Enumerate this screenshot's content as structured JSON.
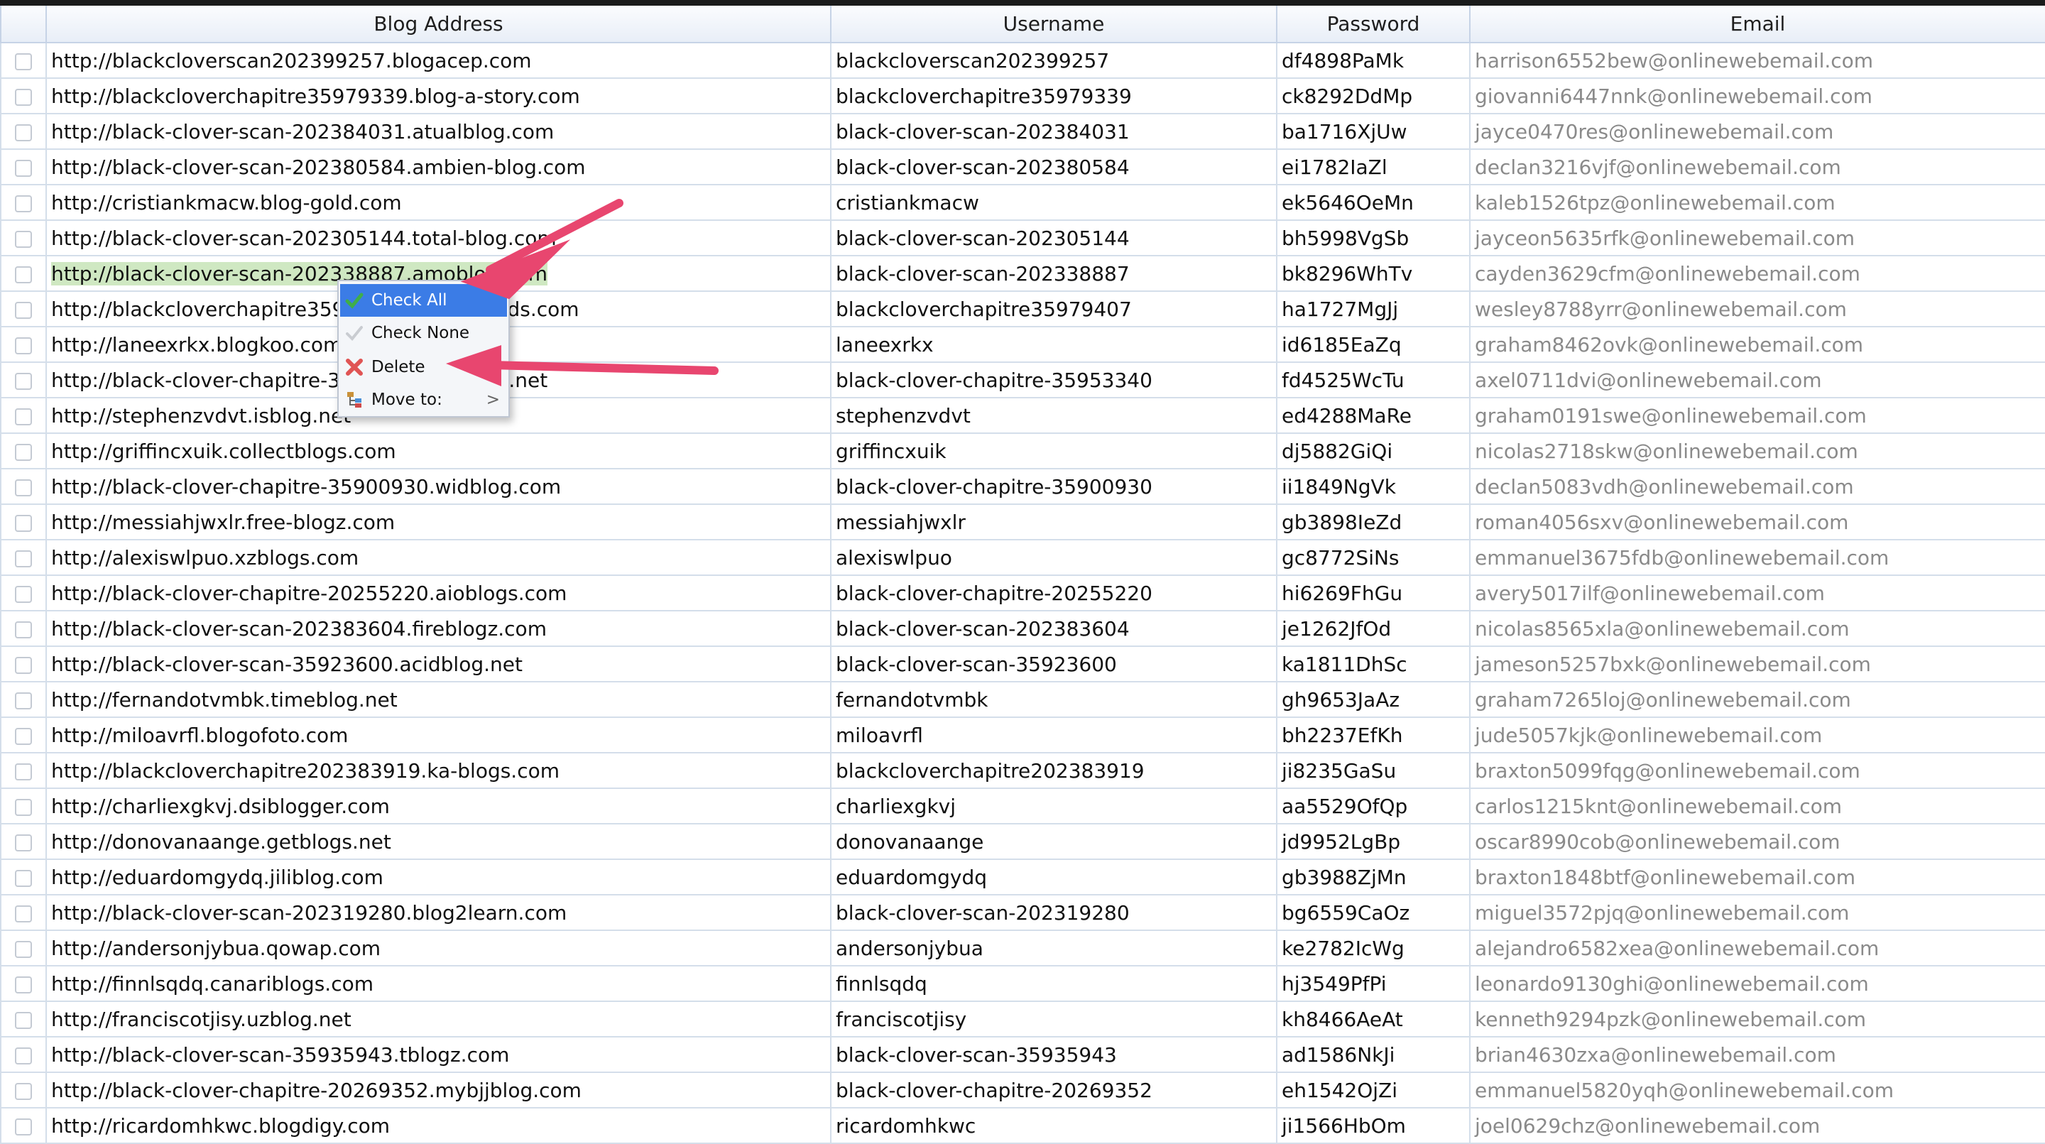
{
  "columns": [
    "",
    "Blog Address",
    "Username",
    "Password",
    "Email"
  ],
  "rows": [
    {
      "blog": "http://blackcloverscan202399257.blogacep.com",
      "user": "blackcloverscan202399257",
      "pass": "df4898PaMk",
      "email": "harrison6552bew@onlinewebemail.com"
    },
    {
      "blog": "http://blackcloverchapitre35979339.blog-a-story.com",
      "user": "blackcloverchapitre35979339",
      "pass": "ck8292DdMp",
      "email": "giovanni6447nnk@onlinewebemail.com"
    },
    {
      "blog": "http://black-clover-scan-202384031.atualblog.com",
      "user": "black-clover-scan-202384031",
      "pass": "ba1716XjUw",
      "email": "jayce0470res@onlinewebemail.com"
    },
    {
      "blog": "http://black-clover-scan-202380584.ambien-blog.com",
      "user": "black-clover-scan-202380584",
      "pass": "ei1782IaZl",
      "email": "declan3216vjf@onlinewebemail.com"
    },
    {
      "blog": "http://cristiankmacw.blog-gold.com",
      "user": "cristiankmacw",
      "pass": "ek5646OeMn",
      "email": "kaleb1526tpz@onlinewebemail.com"
    },
    {
      "blog": "http://black-clover-scan-202305144.total-blog.com",
      "user": "black-clover-scan-202305144",
      "pass": "bh5998VgSb",
      "email": "jayceon5635rfk@onlinewebemail.com"
    },
    {
      "blog": "http://black-clover-scan-202338887.amoblog.com",
      "user": "black-clover-scan-202338887",
      "pass": "bk8296WhTv",
      "email": "cayden3629cfm@onlinewebemail.com"
    },
    {
      "blog": "http://blackcloverchapitre35979407.bloggin-ads.com",
      "user": "blackcloverchapitre35979407",
      "pass": "ha1727MgJj",
      "email": "wesley8788yrr@onlinewebemail.com"
    },
    {
      "blog": "http://laneexrkx.blogkoo.com",
      "user": "laneexrkx",
      "pass": "id6185EaZq",
      "email": "graham8462ovk@onlinewebemail.com"
    },
    {
      "blog": "http://black-clover-chapitre-35953340.bloggin.net",
      "user": "black-clover-chapitre-35953340",
      "pass": "fd4525WcTu",
      "email": "axel0711dvi@onlinewebemail.com"
    },
    {
      "blog": "http://stephenzvdvt.isblog.net",
      "user": "stephenzvdvt",
      "pass": "ed4288MaRe",
      "email": "graham0191swe@onlinewebemail.com"
    },
    {
      "blog": "http://griffincxuik.collectblogs.com",
      "user": "griffincxuik",
      "pass": "dj5882GiQi",
      "email": "nicolas2718skw@onlinewebemail.com"
    },
    {
      "blog": "http://black-clover-chapitre-35900930.widblog.com",
      "user": "black-clover-chapitre-35900930",
      "pass": "ii1849NgVk",
      "email": "declan5083vdh@onlinewebemail.com"
    },
    {
      "blog": "http://messiahjwxlr.free-blogz.com",
      "user": "messiahjwxlr",
      "pass": "gb3898IeZd",
      "email": "roman4056sxv@onlinewebemail.com"
    },
    {
      "blog": "http://alexiswlpuo.xzblogs.com",
      "user": "alexiswlpuo",
      "pass": "gc8772SiNs",
      "email": "emmanuel3675fdb@onlinewebemail.com"
    },
    {
      "blog": "http://black-clover-chapitre-20255220.aioblogs.com",
      "user": "black-clover-chapitre-20255220",
      "pass": "hi6269FhGu",
      "email": "avery5017ilf@onlinewebemail.com"
    },
    {
      "blog": "http://black-clover-scan-202383604.fireblogz.com",
      "user": "black-clover-scan-202383604",
      "pass": "je1262JfOd",
      "email": "nicolas8565xla@onlinewebemail.com"
    },
    {
      "blog": "http://black-clover-scan-35923600.acidblog.net",
      "user": "black-clover-scan-35923600",
      "pass": "ka1811DhSc",
      "email": "jameson5257bxk@onlinewebemail.com"
    },
    {
      "blog": "http://fernandotvmbk.timeblog.net",
      "user": "fernandotvmbk",
      "pass": "gh9653JaAz",
      "email": "graham7265loj@onlinewebemail.com"
    },
    {
      "blog": "http://miloavrfl.blogofoto.com",
      "user": "miloavrfl",
      "pass": "bh2237EfKh",
      "email": "jude5057kjk@onlinewebemail.com"
    },
    {
      "blog": "http://blackcloverchapitre202383919.ka-blogs.com",
      "user": "blackcloverchapitre202383919",
      "pass": "ji8235GaSu",
      "email": "braxton5099fqg@onlinewebemail.com"
    },
    {
      "blog": "http://charliexgkvj.dsiblogger.com",
      "user": "charliexgkvj",
      "pass": "aa5529OfQp",
      "email": "carlos1215knt@onlinewebemail.com"
    },
    {
      "blog": "http://donovanaange.getblogs.net",
      "user": "donovanaange",
      "pass": "jd9952LgBp",
      "email": "oscar8990cob@onlinewebemail.com"
    },
    {
      "blog": "http://eduardomgydq.jiliblog.com",
      "user": "eduardomgydq",
      "pass": "gb3988ZjMn",
      "email": "braxton1848btf@onlinewebemail.com"
    },
    {
      "blog": "http://black-clover-scan-202319280.blog2learn.com",
      "user": "black-clover-scan-202319280",
      "pass": "bg6559CaOz",
      "email": "miguel3572pjq@onlinewebemail.com"
    },
    {
      "blog": "http://andersonjybua.qowap.com",
      "user": "andersonjybua",
      "pass": "ke2782IcWg",
      "email": "alejandro6582xea@onlinewebemail.com"
    },
    {
      "blog": "http://finnlsqdq.canariblogs.com",
      "user": "finnlsqdq",
      "pass": "hj3549PfPi",
      "email": "leonardo9130ghi@onlinewebemail.com"
    },
    {
      "blog": "http://franciscotjisy.uzblog.net",
      "user": "franciscotjisy",
      "pass": "kh8466AeAt",
      "email": "kenneth9294pzk@onlinewebemail.com"
    },
    {
      "blog": "http://black-clover-scan-35935943.tblogz.com",
      "user": "black-clover-scan-35935943",
      "pass": "ad1586NkJi",
      "email": "brian4630zxa@onlinewebemail.com"
    },
    {
      "blog": "http://black-clover-chapitre-20269352.mybjjblog.com",
      "user": "black-clover-chapitre-20269352",
      "pass": "eh1542OjZi",
      "email": "emmanuel5820yqh@onlinewebemail.com"
    },
    {
      "blog": "http://ricardomhkwc.blogdigy.com",
      "user": "ricardomhkwc",
      "pass": "ji1566HbOm",
      "email": "joel0629chz@onlinewebemail.com"
    }
  ],
  "highlighted_row": 6,
  "context_menu": {
    "items": [
      {
        "label": "Check All",
        "icon": "check-icon"
      },
      {
        "label": "Check None",
        "icon": "check-faded-icon"
      },
      {
        "label": "Delete",
        "icon": "delete-x-icon"
      },
      {
        "label": "Move to:",
        "icon": "folder-tree-icon",
        "submenu_indicator": ">"
      }
    ],
    "selected_index": 0
  },
  "colors": {
    "menu_selected": "#3b7ce6",
    "row_highlight": "#cfe8c2",
    "annotation_arrow": "#e8466f",
    "delete_icon": "#e05454",
    "check_icon": "#3fae49"
  }
}
